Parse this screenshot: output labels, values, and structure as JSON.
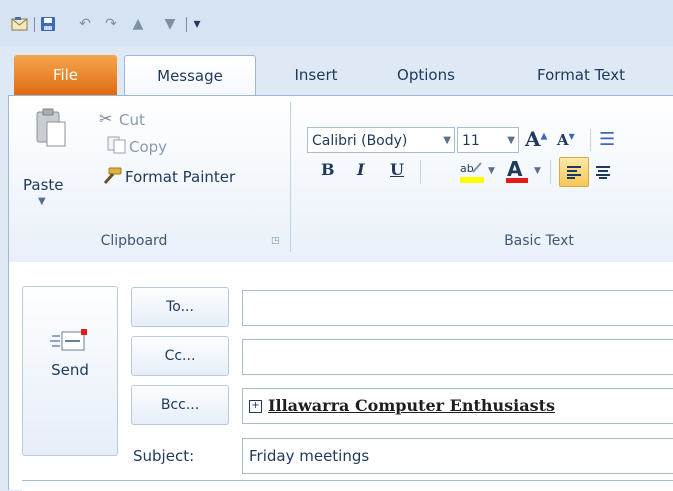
{
  "quick_access": {
    "icons": [
      "outlook-app-icon",
      "save-icon",
      "undo-icon",
      "redo-icon",
      "up-arrow-icon",
      "down-arrow-icon",
      "customize-icon"
    ]
  },
  "tabs": [
    {
      "label": "File"
    },
    {
      "label": "Message"
    },
    {
      "label": "Insert"
    },
    {
      "label": "Options"
    },
    {
      "label": "Format Text"
    }
  ],
  "ribbon": {
    "clipboard": {
      "paste_label": "Paste",
      "cut_label": "Cut",
      "copy_label": "Copy",
      "format_painter_label": "Format Painter",
      "group_label": "Clipboard"
    },
    "basic_text": {
      "font_name": "Calibri (Body)",
      "font_size": "11",
      "bold": "B",
      "italic": "I",
      "underline": "U",
      "group_label": "Basic Text"
    }
  },
  "compose": {
    "send_label": "Send",
    "to_label": "To...",
    "cc_label": "Cc...",
    "bcc_label": "Bcc...",
    "to_value": "",
    "cc_value": "",
    "bcc_value": "Illawarra Computer Enthusiasts",
    "subject_label": "Subject:",
    "subject_value": "Friday meetings"
  },
  "colors": {
    "file_tab": "#e06b12",
    "highlight": "#ffff00",
    "font_color": "#e31b1b"
  }
}
